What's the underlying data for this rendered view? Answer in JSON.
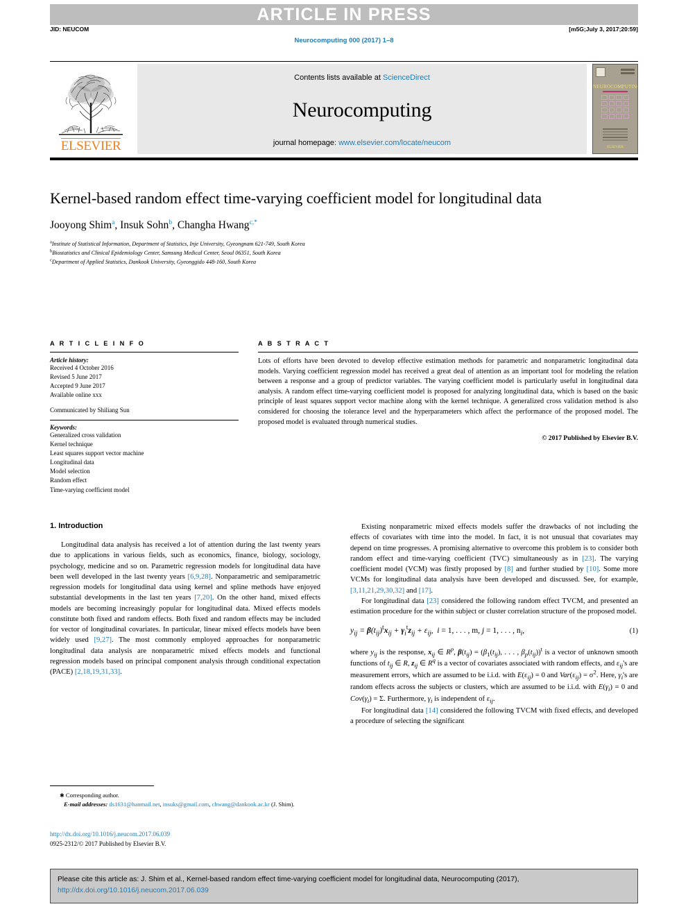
{
  "banner": {
    "article_in_press": "ARTICLE IN PRESS",
    "jid": "JID: NEUCOM",
    "build_stamp": "[m5G;July 3, 2017;20:59]",
    "journal_ref": "Neurocomputing 000 (2017) 1–8"
  },
  "masthead": {
    "contents_prefix": "Contents lists available at ",
    "sciencedirect": "ScienceDirect",
    "journal_name": "Neurocomputing",
    "homepage_prefix": "journal homepage: ",
    "homepage_url": "www.elsevier.com/locate/neucom",
    "publisher": "ELSEVIER",
    "cover_title": "NEUROCOMPUTING"
  },
  "article": {
    "title": "Kernel-based random effect time-varying coefficient model for longitudinal data",
    "authors_plain": "Jooyong Shim, Insuk Sohn, Changha Hwang",
    "authors": [
      {
        "name": "Jooyong Shim",
        "mark": "a"
      },
      {
        "name": "Insuk Sohn",
        "mark": "b"
      },
      {
        "name": "Changha Hwang",
        "mark": "c,*"
      }
    ],
    "affiliations": [
      {
        "mark": "a",
        "text": "Institute of Statistical Information, Department of Statistics, Inje University, Gyeongnam 621-749, South Korea"
      },
      {
        "mark": "b",
        "text": "Biostatistics and Clinical Epidemiology Center, Samsung Medical Center, Seoul 06351, South Korea"
      },
      {
        "mark": "c",
        "text": "Department of Applied Statistics, Dankook University, Gyeonggido 448-160, South Korea"
      }
    ]
  },
  "article_info": {
    "heading": "A R T I C L E    I N F O",
    "history_label": "Article history:",
    "history": [
      "Received 4 October 2016",
      "Revised 5 June 2017",
      "Accepted 9 June 2017",
      "Available online xxx"
    ],
    "communicated_by": "Communicated by Shiliang Sun",
    "keywords_label": "Keywords:",
    "keywords": [
      "Generalized cross validation",
      "Kernel technique",
      "Least squares support vector machine",
      "Longitudinal data",
      "Model selection",
      "Random effect",
      "Time-varying coefficient model"
    ]
  },
  "abstract": {
    "heading": "A B S T R A C T",
    "text": "Lots of efforts have been devoted to develop effective estimation methods for parametric and nonparametric longitudinal data models. Varying coefficient regression model has received a great deal of attention as an important tool for modeling the relation between a response and a group of predictor variables. The varying coefficient model is particularly useful in longitudinal data analysis. A random effect time-varying coefficient model is proposed for analyzing longitudinal data, which is based on the basic principle of least squares support vector machine along with the kernel technique. A generalized cross validation method is also considered for choosing the tolerance level and the hyperparameters which affect the performance of the proposed model. The proposed model is evaluated through numerical studies.",
    "copyright": "© 2017 Published by Elsevier B.V."
  },
  "intro": {
    "heading": "1. Introduction",
    "left_p1_a": "Longitudinal data analysis has received a lot of attention during the last twenty years due to applications in various fields, such as economics, finance, biology, sociology, psychology, medicine and so on. Parametric regression models for longitudinal data have been well developed in the last twenty years ",
    "left_ref1": "[6,9,28]",
    "left_p1_b": ". Nonparametric and semiparametric regression models for longitudinal data using kernel and spline methods have enjoyed substantial developments in the last ten years ",
    "left_ref2": "[7,20]",
    "left_p1_c": ". On the other hand, mixed effects models are becoming increasingly popular for longitudinal data. Mixed effects models constitute both fixed and random effects. Both fixed and random effects may be included for vector of longitudinal covariates. In particular, linear mixed effects models have been widely used ",
    "left_ref3": "[9,27]",
    "left_p1_d": ". The most commonly employed approaches for nonparametric longitudinal data analysis are nonparametric mixed effects models and functional regression models based on principal component analysis through conditional expectation (PACE) ",
    "left_ref4": "[2,18,19,31,33]",
    "left_p1_e": ".",
    "right_p1_a": "Existing nonparametric mixed effects models suffer the drawbacks of not including the effects of covariates with time into the model. In fact, it is not unusual that covariates may depend on time progresses. A promising alternative to overcome this problem is to consider both random effect and time-varying coefficient (TVC) simultaneously as in ",
    "right_ref1": "[23]",
    "right_p1_b": ". The varying coefficient model (VCM) was firstly proposed by ",
    "right_ref2": "[8]",
    "right_p1_c": " and further studied by ",
    "right_ref3": "[10]",
    "right_p1_d": ". Some more VCMs for longitudinal data analysis have been developed and discussed. See, for example, ",
    "right_ref4": "[3,11,21,29,30,32]",
    "right_p1_e": " and ",
    "right_ref5": "[17]",
    "right_p1_f": ".",
    "right_p2_a": "For longitudinal data ",
    "right_ref6": "[23]",
    "right_p2_b": " considered the following random effect TVCM, and presented an estimation procedure for the within subject or cluster correlation structure of the proposed model.",
    "equation_number": "(1)",
    "right_p3_a": "where ",
    "right_p3_b": " is the response, ",
    "right_p3_text": "where y_ij is the response, x_ij ∈ R^p, β(t_ij) = (β_1(t_ij), …, β_p(t_ij))^t is a vector of unknown smooth functions of t_ij ∈ R, z_ij ∈ R^q is a vector of covariates associated with random effects, and ε_ij's are measurement errors, which are assumed to be i.i.d. with E(ε_ij) = 0 and Var(ε_ij) = σ². Here, γ_i's are random effects across the subjects or clusters, which are assumed to be i.i.d. with E(γ_i) = 0 and Cov(γ_i) = Σ. Furthermore, γ_i is independent of ε_ij.",
    "right_p4_a": "For longitudinal data ",
    "right_ref7": "[14]",
    "right_p4_b": " considered the following TVCM with fixed effects, and developed a procedure of selecting the significant"
  },
  "footnote": {
    "corresponding": "Corresponding author.",
    "email_label": "E-mail addresses:",
    "emails": [
      "ds1631@hanmail.net",
      "insuks@gmail.com",
      "chwang@dankook.ac.kr"
    ],
    "email_attrib": "(J. Shim).",
    "doi_url": "http://dx.doi.org/10.1016/j.neucom.2017.06.039",
    "issn_line": "0925-2312/© 2017 Published by Elsevier B.V."
  },
  "cite_box": {
    "text_a": "Please cite this article as: J. Shim et al., Kernel-based random effect time-varying coefficient model for longitudinal data, Neurocomputing (2017), ",
    "link": "http://dx.doi.org/10.1016/j.neucom.2017.06.039"
  },
  "colors": {
    "link": "#1f7bb6",
    "elsevier_orange": "#F07F1A",
    "banner_gray": "#bdbdbd",
    "cite_gray": "#c9c9c9"
  }
}
